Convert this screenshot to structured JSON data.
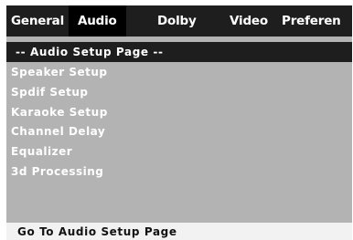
{
  "tabs": [
    {
      "label": "General",
      "active": false
    },
    {
      "label": "Audio",
      "active": true
    },
    {
      "label": "Dolby",
      "active": false
    },
    {
      "label": "Video",
      "active": false
    },
    {
      "label": "Preferen",
      "active": false
    }
  ],
  "page_header": "-- Audio Setup Page --",
  "menu": {
    "items": [
      {
        "label": "Speaker Setup"
      },
      {
        "label": "Spdif Setup"
      },
      {
        "label": "Karaoke Setup"
      },
      {
        "label": "Channel Delay"
      },
      {
        "label": "Equalizer"
      },
      {
        "label": "3d Processing"
      }
    ]
  },
  "status": {
    "text": "Go To Audio Setup Page"
  },
  "colors": {
    "tab_bar": "#1e1e1e",
    "active_tab": "#000000",
    "panel": "#b3b3b3",
    "status_bar": "#f2f2f2"
  }
}
